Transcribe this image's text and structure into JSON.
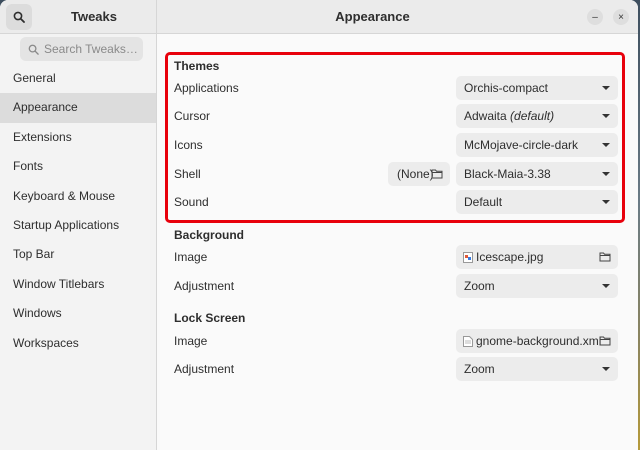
{
  "header": {
    "app_title": "Tweaks",
    "page_title": "Appearance",
    "minimize_label": "–",
    "close_label": "×"
  },
  "sidebar": {
    "search_placeholder": "Search Tweaks…",
    "items": [
      {
        "label": "General"
      },
      {
        "label": "Appearance"
      },
      {
        "label": "Extensions"
      },
      {
        "label": "Fonts"
      },
      {
        "label": "Keyboard & Mouse"
      },
      {
        "label": "Startup Applications"
      },
      {
        "label": "Top Bar"
      },
      {
        "label": "Window Titlebars"
      },
      {
        "label": "Windows"
      },
      {
        "label": "Workspaces"
      }
    ],
    "active_item": "Appearance"
  },
  "themes": {
    "title": "Themes",
    "applications_label": "Applications",
    "applications_value": "Orchis-compact",
    "cursor_label": "Cursor",
    "cursor_value": "Adwaita",
    "cursor_default": "(default)",
    "icons_label": "Icons",
    "icons_value": "McMojave-circle-dark",
    "shell_label": "Shell",
    "shell_file": "(None)",
    "shell_value": "Black-Maia-3.38",
    "sound_label": "Sound",
    "sound_value": "Default"
  },
  "background": {
    "title": "Background",
    "image_label": "Image",
    "image_value": "Icescape.jpg",
    "adjustment_label": "Adjustment",
    "adjustment_value": "Zoom"
  },
  "lock_screen": {
    "title": "Lock Screen",
    "image_label": "Image",
    "image_value": "gnome-background.xml",
    "adjustment_label": "Adjustment",
    "adjustment_value": "Zoom"
  },
  "colors": {
    "highlight": "#e8000c",
    "active_item_bg": "#dcdcdc"
  }
}
